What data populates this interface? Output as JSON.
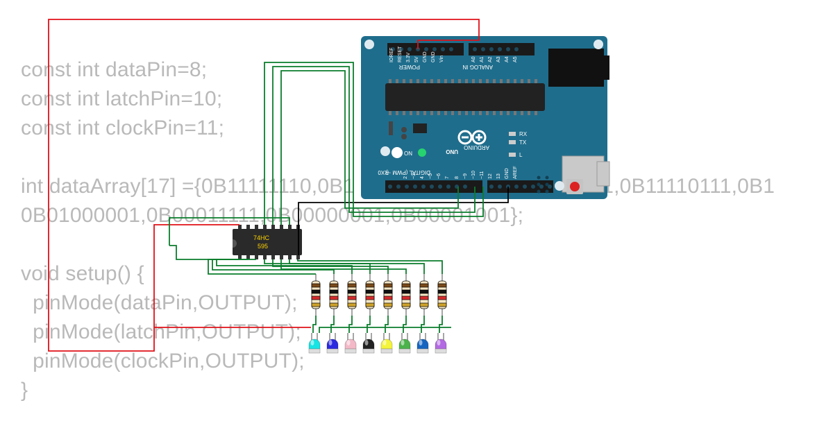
{
  "code": {
    "l1": "const int dataPin=8;",
    "l2": "const int latchPin=10;",
    "l3": "const int clockPin=11;",
    "l4": "",
    "l5": "int dataArray[17] ={0B11111110,0B1                                      011,0B11110111,0B1",
    "l6": "0B01000001,0B00011111,0B00000001,0B00001001};",
    "l7": "",
    "l8": "void setup() {",
    "l9": "  pinMode(dataPin,OUTPUT);",
    "l10": "  pinMode(latchPin,OUTPUT);",
    "l11": "  pinMode(clockPin,OUTPUT);",
    "l12": "}"
  },
  "arduino": {
    "board_name": "UNO",
    "brand": "ARDUINO",
    "on_label": "ON",
    "rx_label": "RX",
    "tx_label": "TX",
    "l_label": "L",
    "power_label": "POWER",
    "analog_label": "ANALOG IN",
    "digital_label": "DIGITAL (PWM ~)",
    "rx0_label": "RX0",
    "top_pins": [
      "IOREF",
      "RESET",
      "3.3V",
      "5V",
      "GND",
      "GND",
      "Vin",
      "",
      "A0",
      "A1",
      "A2",
      "A3",
      "A4",
      "A5"
    ],
    "bottom_pins": [
      "AREF",
      "GND",
      "13",
      "12",
      "~11",
      "~10",
      "~9",
      "8",
      "",
      "7",
      "~6",
      "~5",
      "4",
      "~3",
      "2",
      "TX→1",
      "RX←0"
    ]
  },
  "chip": {
    "label1": "74HC",
    "label2": "595"
  },
  "leds": [
    {
      "color": "#17e4e4",
      "name": "led-cyan"
    },
    {
      "color": "#2a2ae0",
      "name": "led-blue"
    },
    {
      "color": "#f3b9c7",
      "name": "led-pink"
    },
    {
      "color": "#222222",
      "name": "led-black"
    },
    {
      "color": "#f4f43a",
      "name": "led-yellow"
    },
    {
      "color": "#4cb24c",
      "name": "led-green"
    },
    {
      "color": "#1565c0",
      "name": "led-blue2"
    },
    {
      "color": "#b36ae2",
      "name": "led-purple"
    }
  ],
  "resistor": {
    "bands": [
      "brown",
      "black",
      "red",
      "gold"
    ]
  }
}
